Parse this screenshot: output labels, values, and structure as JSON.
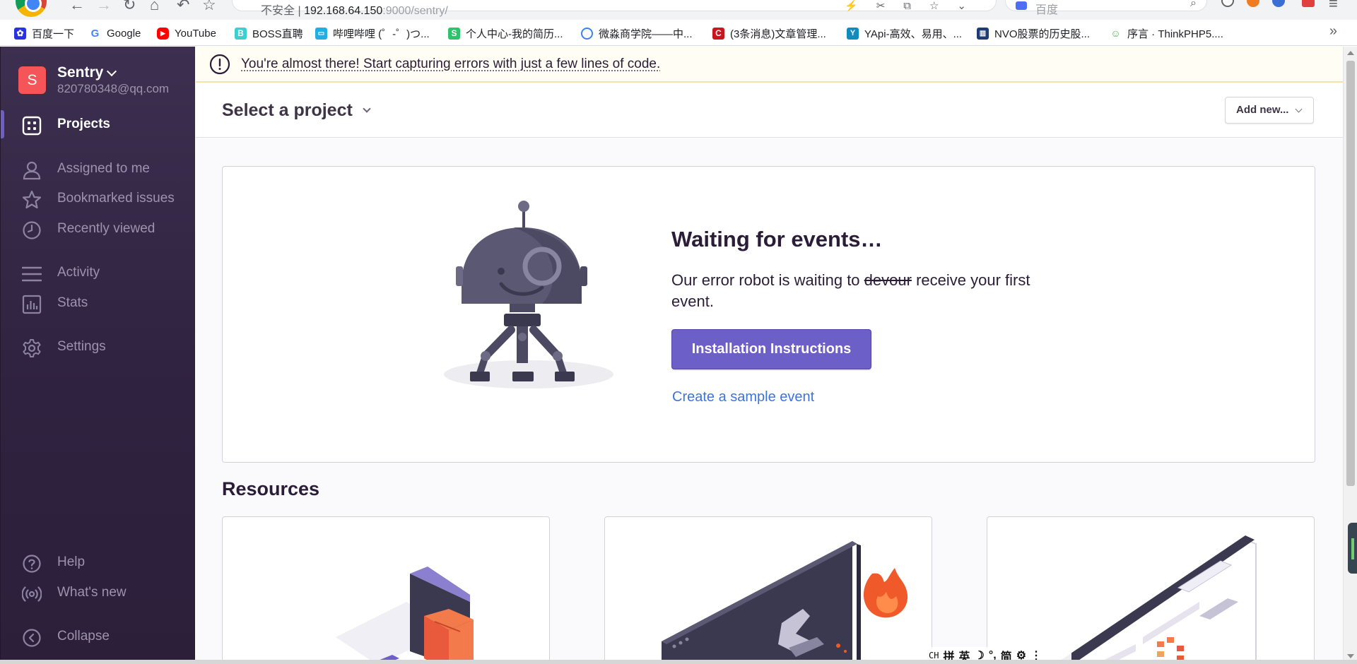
{
  "browser": {
    "url": {
      "insecure_label": "不安全",
      "host": "192.168.64.150",
      "rest": ":9000/sentry/"
    },
    "search_engine": "百度",
    "bookmarks": [
      {
        "label": "百度一下",
        "icon": "baidu-paw-icon",
        "color": "#2932e1"
      },
      {
        "label": "Google",
        "icon": "google-g-icon",
        "color": "#4285f4"
      },
      {
        "label": "YouTube",
        "icon": "youtube-icon",
        "color": "#ff0000"
      },
      {
        "label": "BOSS直聘",
        "icon": "boss-icon",
        "color": "#3ccfcf"
      },
      {
        "label": "哔哩哔哩 (゜-゜)つ...",
        "icon": "bilibili-icon",
        "color": "#23ade5"
      },
      {
        "label": "个人中心-我的简历...",
        "icon": "resume-s-icon",
        "color": "#2dc26b"
      },
      {
        "label": "微淼商学院——中...",
        "icon": "weimiao-icon",
        "color": "#3b82f6"
      },
      {
        "label": "(3条消息)文章管理...",
        "icon": "csdn-c-icon",
        "color": "#c9151e"
      },
      {
        "label": "YApi-高效、易用、...",
        "icon": "yapi-icon",
        "color": "#0f8bbd"
      },
      {
        "label": "NVO股票的历史股...",
        "icon": "nvo-chart-icon",
        "color": "#1f3b73"
      },
      {
        "label": "序言 · ThinkPHP5....",
        "icon": "thinkphp-icon",
        "color": "#4caf50"
      }
    ]
  },
  "org": {
    "initial": "S",
    "name": "Sentry",
    "email": "820780348@qq.com"
  },
  "sidebar": {
    "items": [
      {
        "label": "Projects",
        "icon": "projects-grid-icon",
        "active": true
      },
      {
        "label": "Assigned to me",
        "icon": "user-icon",
        "active": false
      },
      {
        "label": "Bookmarked issues",
        "icon": "star-icon",
        "active": false
      },
      {
        "label": "Recently viewed",
        "icon": "clock-icon",
        "active": false
      },
      {
        "label": "Activity",
        "icon": "activity-lines-icon",
        "active": false
      },
      {
        "label": "Stats",
        "icon": "stats-bar-icon",
        "active": false
      },
      {
        "label": "Settings",
        "icon": "gear-icon",
        "active": false
      },
      {
        "label": "Help",
        "icon": "help-circle-icon",
        "active": false
      },
      {
        "label": "What's new",
        "icon": "broadcast-icon",
        "active": false
      },
      {
        "label": "Collapse",
        "icon": "collapse-chevron-icon",
        "active": false
      }
    ]
  },
  "notice": {
    "text": "You're almost there! Start capturing errors with just a few lines of code."
  },
  "header": {
    "project_select": "Select a project",
    "add_new": "Add new..."
  },
  "waiting": {
    "title": "Waiting for events…",
    "body_before": "Our error robot is waiting to ",
    "body_strike": "devour",
    "body_after": " receive your first event.",
    "install_button": "Installation Instructions",
    "sample_link": "Create a sample event"
  },
  "resources": {
    "heading": "Resources"
  },
  "ime": {
    "ch": "CH",
    "pin": "拼",
    "ying": "英",
    "jian": "简"
  },
  "colors": {
    "accent": "#6c5fc7",
    "sidebar_bg": "#2f2240",
    "link": "#3d74db",
    "org_avatar": "#f55459"
  }
}
